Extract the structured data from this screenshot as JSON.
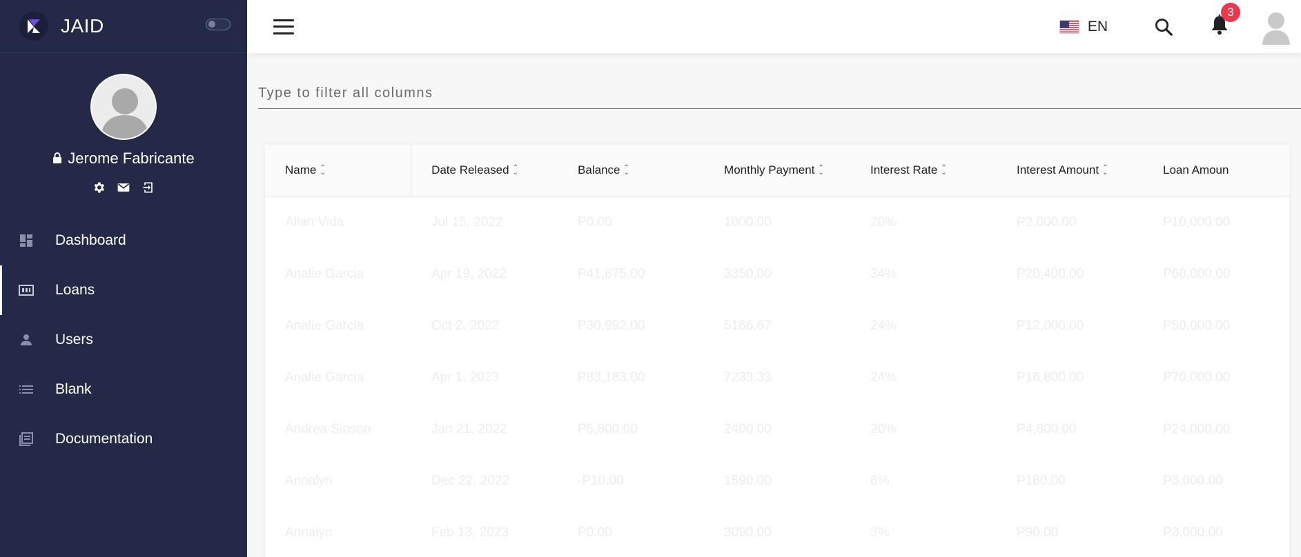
{
  "brand": {
    "name": "JAID"
  },
  "profile": {
    "name": "Jerome Fabricante"
  },
  "nav": {
    "items": [
      {
        "label": "Dashboard",
        "icon": "dashboard-icon"
      },
      {
        "label": "Loans",
        "icon": "loans-icon"
      },
      {
        "label": "Users",
        "icon": "user-icon"
      },
      {
        "label": "Blank",
        "icon": "list-icon"
      },
      {
        "label": "Documentation",
        "icon": "documentation-icon"
      }
    ],
    "active": "Loans"
  },
  "topbar": {
    "language": "EN",
    "notifications_count": "3"
  },
  "filter": {
    "placeholder": "Type to filter all columns"
  },
  "table": {
    "columns": [
      "Name",
      "Date Released",
      "Balance",
      "Monthly Payment",
      "Interest Rate",
      "Interest Amount",
      "Loan Amoun"
    ],
    "rows": [
      [
        "Allan Vida",
        "Jul 15, 2022",
        "P0.00",
        "1000.00",
        "20%",
        "P2,000.00",
        "P10,000.00"
      ],
      [
        "Analie Garcia",
        "Apr 19, 2022",
        "P41,875.00",
        "3350.00",
        "34%",
        "P20,400.00",
        "P60,000.00"
      ],
      [
        "Analie Garcia",
        "Oct 2, 2022",
        "P30,992.00",
        "5166.67",
        "24%",
        "P12,000.00",
        "P50,000.00"
      ],
      [
        "Analie Garcia",
        "Apr 1, 2023",
        "P83,183.00",
        "7233.33",
        "24%",
        "P16,800.00",
        "P70,000.00"
      ],
      [
        "Andrea Sioson",
        "Jan 21, 2022",
        "P5,800.00",
        "2400.00",
        "20%",
        "P4,800.00",
        "P24,000.00"
      ],
      [
        "Annalyn",
        "Dec 22, 2022",
        "-P10.00",
        "1590.00",
        "6%",
        "P180.00",
        "P3,000.00"
      ],
      [
        "Annalyn",
        "Feb 13, 2023",
        "P0.00",
        "3090.00",
        "3%",
        "P90.00",
        "P3,000.00"
      ]
    ]
  },
  "colors": {
    "sidebar_bg": "#232946",
    "badge": "#e8394d",
    "row_text": "#ededed"
  }
}
